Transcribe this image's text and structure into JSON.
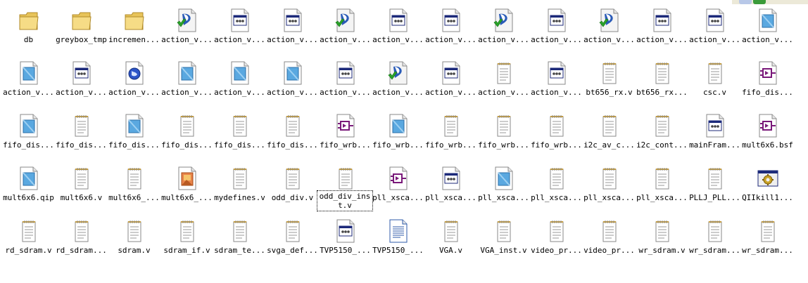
{
  "explorer": {
    "items": [
      {
        "label": "db",
        "icon": "folder-icon"
      },
      {
        "label": "greybox_tmp",
        "icon": "folder-icon"
      },
      {
        "label": "incremen...",
        "icon": "folder-icon"
      },
      {
        "label": "action_v...",
        "icon": "vstudio-file-icon"
      },
      {
        "label": "action_v...",
        "icon": "app-window-file-icon"
      },
      {
        "label": "action_v...",
        "icon": "app-window-file-icon"
      },
      {
        "label": "action_v...",
        "icon": "vstudio-file-icon"
      },
      {
        "label": "action_v...",
        "icon": "app-window-file-icon"
      },
      {
        "label": "action_v...",
        "icon": "app-window-file-icon"
      },
      {
        "label": "action_v...",
        "icon": "vstudio-file-icon"
      },
      {
        "label": "action_v...",
        "icon": "app-window-file-icon"
      },
      {
        "label": "action_v...",
        "icon": "vstudio-file-icon"
      },
      {
        "label": "action_v...",
        "icon": "app-window-file-icon"
      },
      {
        "label": "action_v...",
        "icon": "app-window-file-icon"
      },
      {
        "label": "action_v...",
        "icon": "blue-doc-file-icon"
      },
      {
        "label": "action_v...",
        "icon": "blue-doc-file-icon"
      },
      {
        "label": "action_v...",
        "icon": "app-window-file-icon"
      },
      {
        "label": "action_v...",
        "icon": "globe-file-icon"
      },
      {
        "label": "action_v...",
        "icon": "blue-doc-file-icon"
      },
      {
        "label": "action_v...",
        "icon": "blue-doc-file-icon"
      },
      {
        "label": "action_v...",
        "icon": "blue-doc-file-icon"
      },
      {
        "label": "action_v...",
        "icon": "app-window-file-icon"
      },
      {
        "label": "action_v...",
        "icon": "vstudio-file-icon"
      },
      {
        "label": "action_v...",
        "icon": "app-window-file-icon"
      },
      {
        "label": "action_v...",
        "icon": "notepad-file-icon"
      },
      {
        "label": "action_v...",
        "icon": "app-window-file-icon"
      },
      {
        "label": "bt656_rx.v",
        "icon": "notepad-file-icon"
      },
      {
        "label": "bt656_rx...",
        "icon": "notepad-file-icon"
      },
      {
        "label": "csc.v",
        "icon": "notepad-file-icon"
      },
      {
        "label": "fifo_dis...",
        "icon": "symbol-file-icon"
      },
      {
        "label": "fifo_dis...",
        "icon": "blue-doc-file-icon"
      },
      {
        "label": "fifo_dis...",
        "icon": "notepad-file-icon"
      },
      {
        "label": "fifo_dis...",
        "icon": "blue-doc-file-icon"
      },
      {
        "label": "fifo_dis...",
        "icon": "notepad-file-icon"
      },
      {
        "label": "fifo_dis...",
        "icon": "notepad-file-icon"
      },
      {
        "label": "fifo_dis...",
        "icon": "notepad-file-icon"
      },
      {
        "label": "fifo_wrb...",
        "icon": "symbol-file-icon"
      },
      {
        "label": "fifo_wrb...",
        "icon": "blue-doc-file-icon"
      },
      {
        "label": "fifo_wrb...",
        "icon": "notepad-file-icon"
      },
      {
        "label": "fifo_wrb...",
        "icon": "notepad-file-icon"
      },
      {
        "label": "fifo_wrb...",
        "icon": "notepad-file-icon"
      },
      {
        "label": "i2c_av_c...",
        "icon": "notepad-file-icon"
      },
      {
        "label": "i2c_cont...",
        "icon": "notepad-file-icon"
      },
      {
        "label": "mainFram...",
        "icon": "app-window-file-icon"
      },
      {
        "label": "mult6x6.bsf",
        "icon": "symbol-file-icon"
      },
      {
        "label": "mult6x6.qip",
        "icon": "blue-doc-file-icon"
      },
      {
        "label": "mult6x6.v",
        "icon": "notepad-file-icon"
      },
      {
        "label": "mult6x6_...",
        "icon": "notepad-file-icon"
      },
      {
        "label": "mult6x6_...",
        "icon": "image-file-icon"
      },
      {
        "label": "mydefines.v",
        "icon": "notepad-file-icon"
      },
      {
        "label": "odd_div.v",
        "icon": "notepad-file-icon"
      },
      {
        "label": "odd_div_inst.v",
        "icon": "notepad-file-icon",
        "selected": true
      },
      {
        "label": "pll_xsca...",
        "icon": "symbol-file-icon"
      },
      {
        "label": "pll_xsca...",
        "icon": "app-window-file-icon"
      },
      {
        "label": "pll_xsca...",
        "icon": "blue-doc-file-icon"
      },
      {
        "label": "pll_xsca...",
        "icon": "notepad-file-icon"
      },
      {
        "label": "pll_xsca...",
        "icon": "notepad-file-icon"
      },
      {
        "label": "pll_xsca...",
        "icon": "notepad-file-icon"
      },
      {
        "label": "PLLJ_PLL...",
        "icon": "notepad-file-icon"
      },
      {
        "label": "QIIkill1...",
        "icon": "gear-app-icon"
      },
      {
        "label": "rd_sdram.v",
        "icon": "notepad-file-icon"
      },
      {
        "label": "rd_sdram...",
        "icon": "notepad-file-icon"
      },
      {
        "label": "sdram.v",
        "icon": "notepad-file-icon"
      },
      {
        "label": "sdram_if.v",
        "icon": "notepad-file-icon"
      },
      {
        "label": "sdram_te...",
        "icon": "notepad-file-icon"
      },
      {
        "label": "svga_def...",
        "icon": "notepad-file-icon"
      },
      {
        "label": "TVP5150_...",
        "icon": "app-window-file-icon"
      },
      {
        "label": "TVP5150_...",
        "icon": "text-doc-file-icon"
      },
      {
        "label": "VGA.v",
        "icon": "notepad-file-icon"
      },
      {
        "label": "VGA_inst.v",
        "icon": "notepad-file-icon"
      },
      {
        "label": "video_pr...",
        "icon": "notepad-file-icon"
      },
      {
        "label": "video_pr...",
        "icon": "notepad-file-icon"
      },
      {
        "label": "wr_sdram.v",
        "icon": "notepad-file-icon"
      },
      {
        "label": "wr_sdram...",
        "icon": "notepad-file-icon"
      },
      {
        "label": "wr_sdram...",
        "icon": "notepad-file-icon"
      }
    ]
  }
}
